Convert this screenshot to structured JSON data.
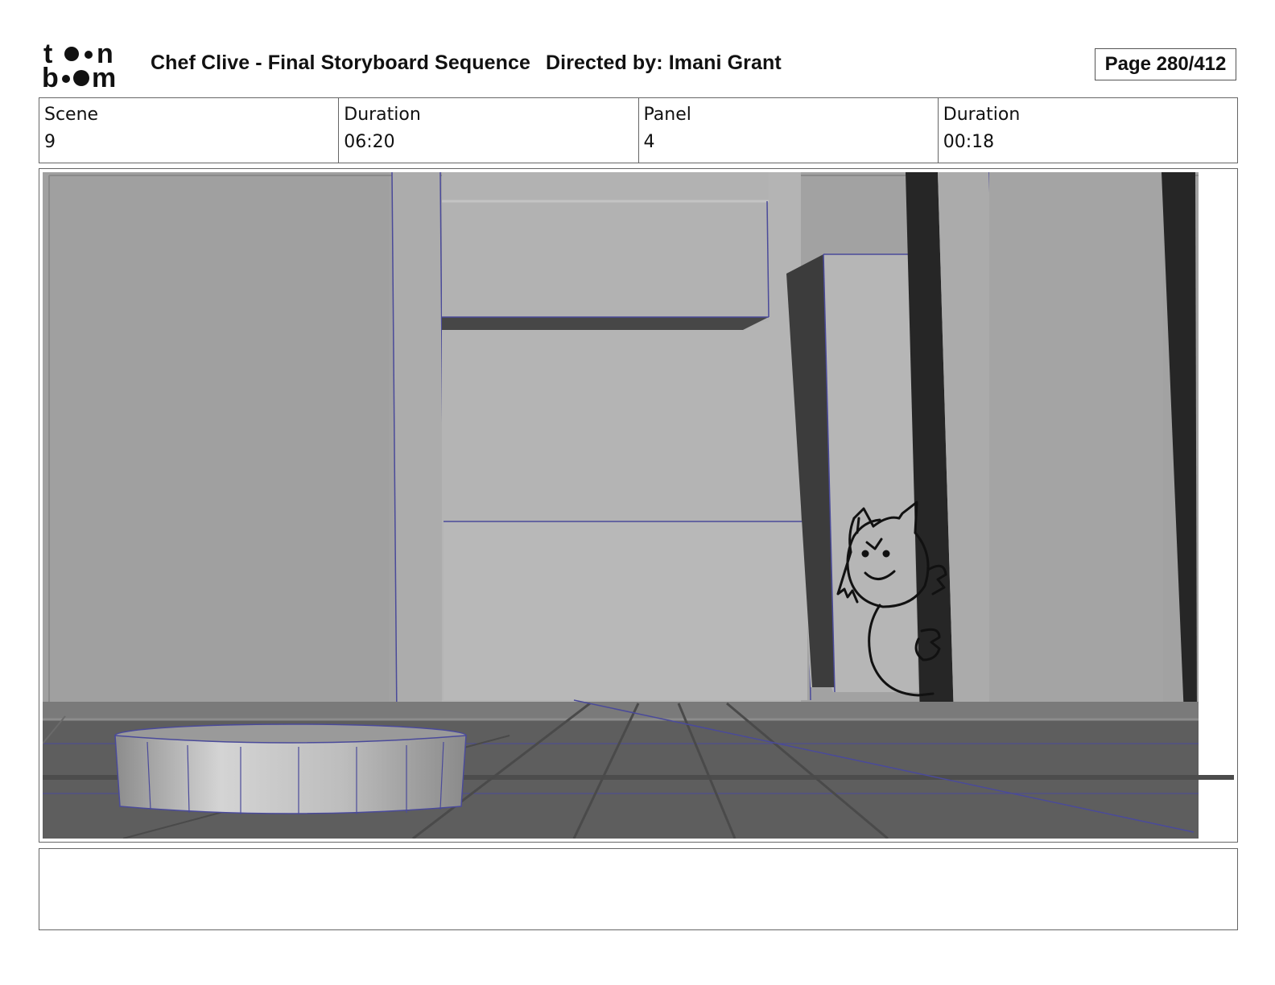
{
  "header": {
    "title": "Chef Clive - Final Storyboard Sequence",
    "director": "Directed by: Imani Grant",
    "page": "Page 280/412"
  },
  "logo": {
    "line1": "toon",
    "line2": "boom"
  },
  "info": {
    "scene_label": "Scene",
    "scene_value": "9",
    "scene_duration_label": "Duration",
    "scene_duration_value": "06:20",
    "panel_label": "Panel",
    "panel_value": "4",
    "panel_duration_label": "Duration",
    "panel_duration_value": "00:18"
  },
  "panel": {
    "illustration": "storyboard-panel-sketch"
  },
  "caption": {
    "text": ""
  }
}
